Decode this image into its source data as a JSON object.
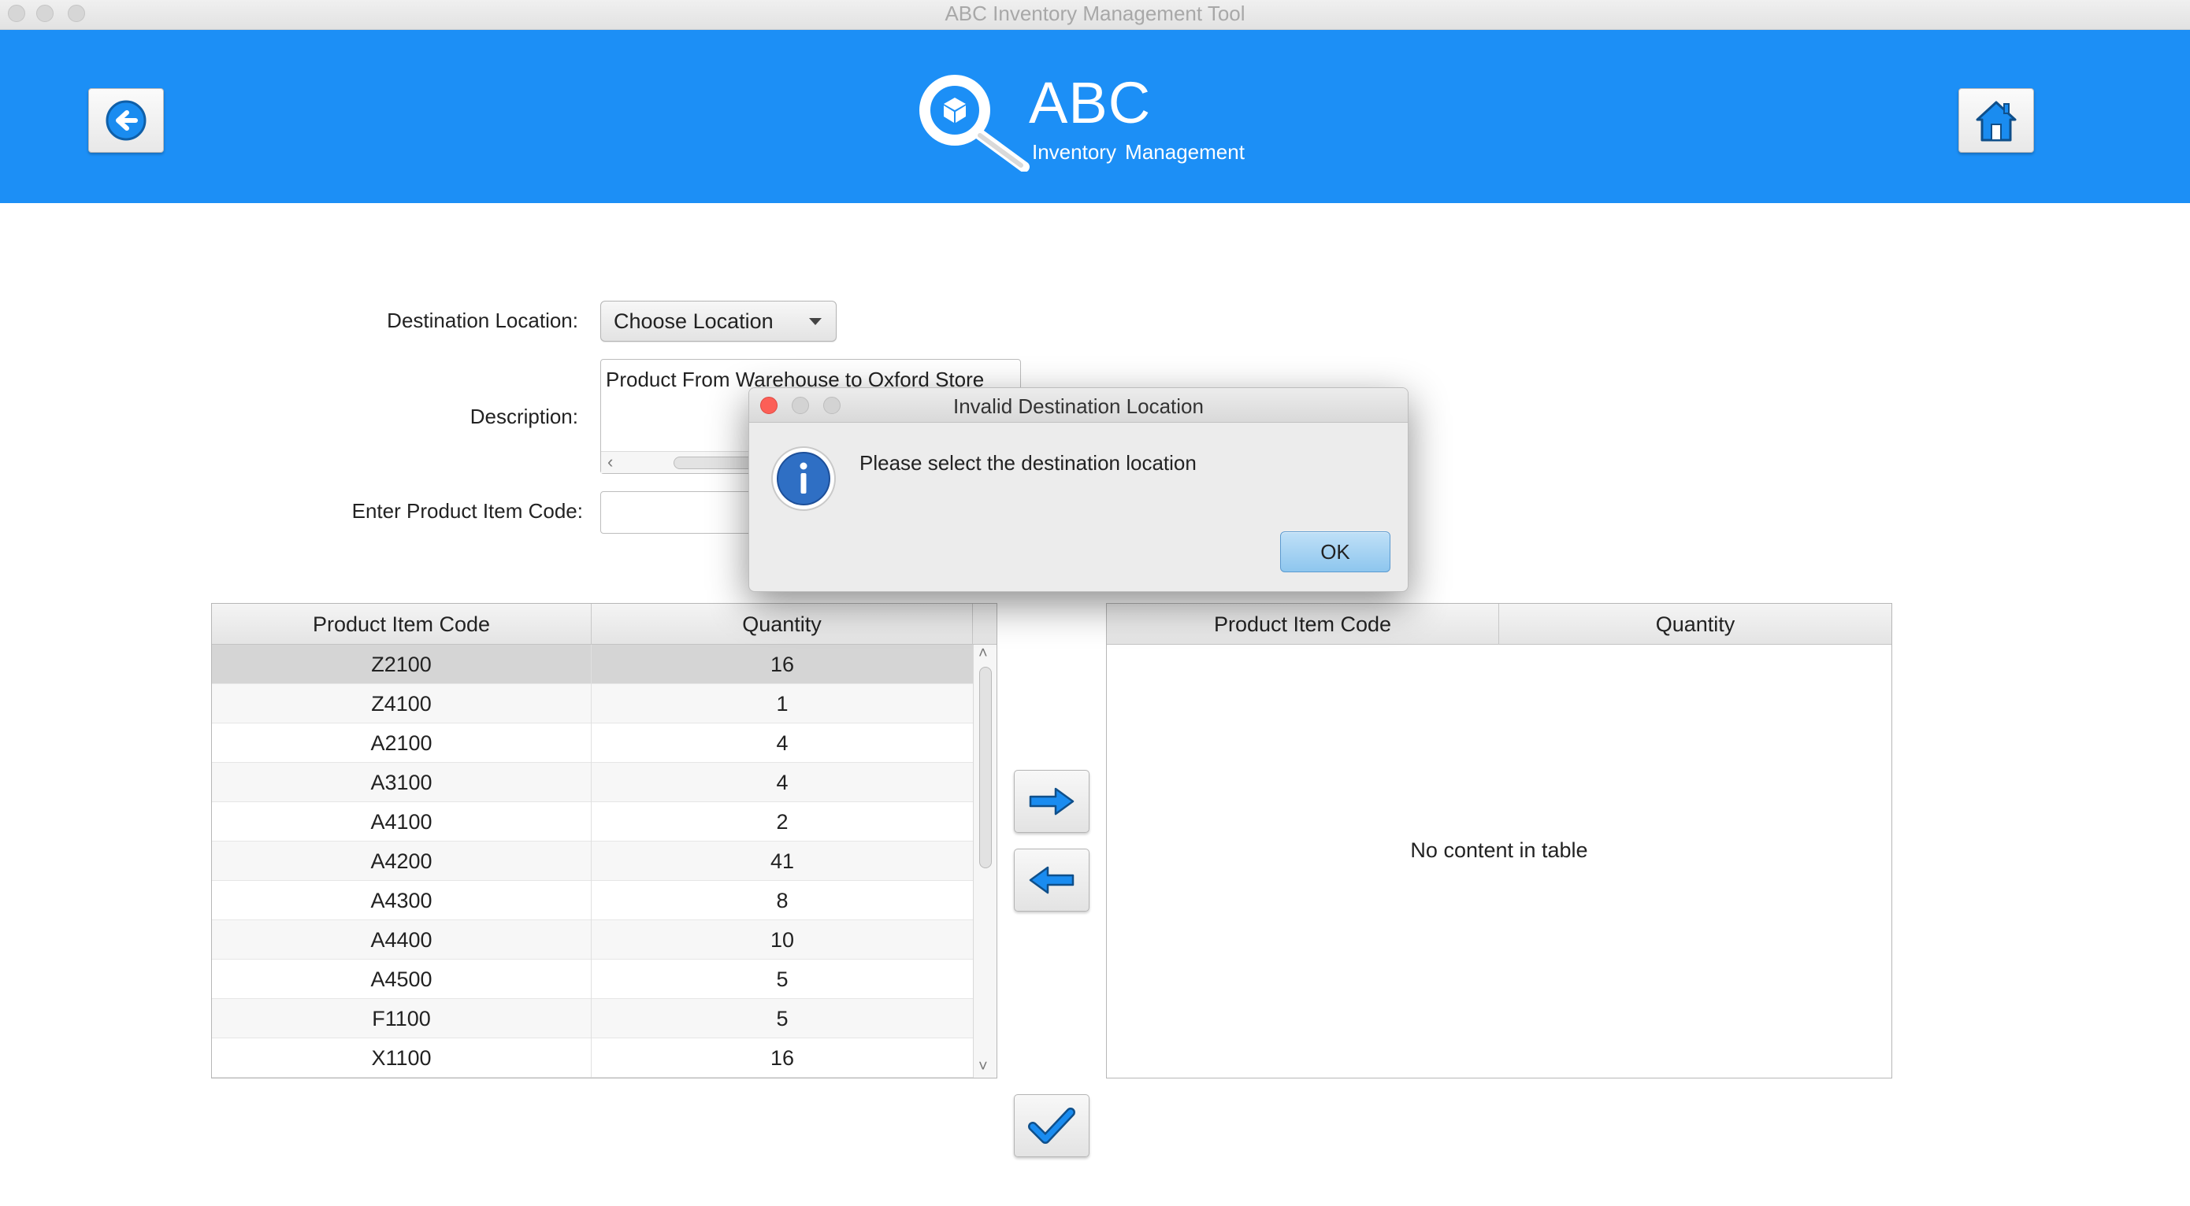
{
  "window": {
    "title": "ABC Inventory Management Tool"
  },
  "header": {
    "brand_name": "ABC",
    "brand_subtitle": "Inventory Management",
    "back_icon": "arrow-left-circle-icon",
    "home_icon": "home-icon",
    "accent_color": "#1c8ff6"
  },
  "form": {
    "destination_label": "Destination Location:",
    "destination_value": "Choose Location",
    "description_label": "Description:",
    "description_value": "Product From Warehouse to Oxford Store",
    "item_code_label": "Enter Product Item Code:",
    "item_code_value": ""
  },
  "source_table": {
    "columns": [
      "Product Item Code",
      "Quantity"
    ],
    "rows": [
      {
        "code": "Z2100",
        "qty": "16"
      },
      {
        "code": "Z4100",
        "qty": "1"
      },
      {
        "code": "A2100",
        "qty": "4"
      },
      {
        "code": "A3100",
        "qty": "4"
      },
      {
        "code": "A4100",
        "qty": "2"
      },
      {
        "code": "A4200",
        "qty": "41"
      },
      {
        "code": "A4300",
        "qty": "8"
      },
      {
        "code": "A4400",
        "qty": "10"
      },
      {
        "code": "A4500",
        "qty": "5"
      },
      {
        "code": "F1100",
        "qty": "5"
      },
      {
        "code": "X1100",
        "qty": "16"
      }
    ]
  },
  "target_table": {
    "columns": [
      "Product Item Code",
      "Quantity"
    ],
    "empty_message": "No content in table"
  },
  "actions": {
    "move_right_icon": "arrow-right-icon",
    "move_left_icon": "arrow-left-icon",
    "confirm_icon": "checkmark-icon"
  },
  "dialog": {
    "title": "Invalid Destination Location",
    "message": "Please select the destination location",
    "ok_label": "OK",
    "icon": "info-icon"
  }
}
